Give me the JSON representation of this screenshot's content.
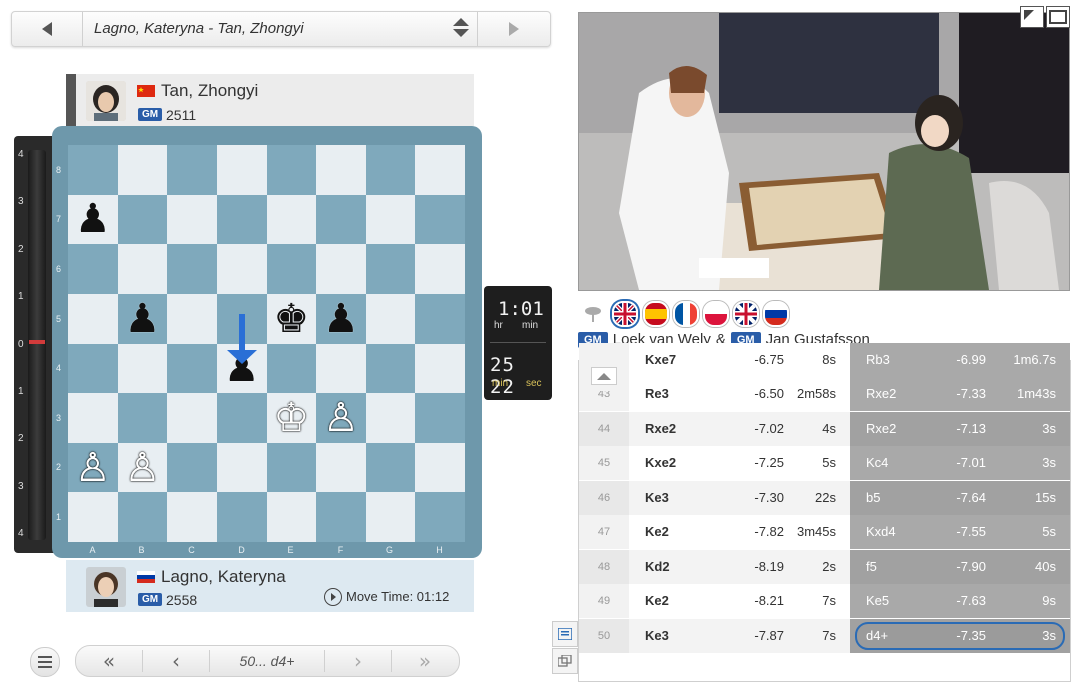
{
  "game_selector": {
    "title": "Lagno, Kateryna - Tan, Zhongyi"
  },
  "top_player": {
    "name": "Tan, Zhongyi",
    "title": "GM",
    "rating": "2511",
    "flag": "china"
  },
  "bottom_player": {
    "name": "Lagno, Kateryna",
    "title": "GM",
    "rating": "2558",
    "flag": "russia",
    "move_time": "Move Time: 01:12"
  },
  "eval_bar": {
    "labels": [
      "4",
      "3",
      "2",
      "1",
      "0",
      "1",
      "2",
      "3",
      "4"
    ],
    "current": "0"
  },
  "board": {
    "ranks": [
      "8",
      "7",
      "6",
      "5",
      "4",
      "3",
      "2",
      "1"
    ],
    "files": [
      "A",
      "B",
      "C",
      "D",
      "E",
      "F",
      "G",
      "H"
    ],
    "last_move_arrow": "d5-d4"
  },
  "clock": {
    "h_m": "1:01",
    "hr": "hr",
    "min": "min",
    "m_s": "25 22",
    "min2": "min",
    "sec": "sec"
  },
  "nav": {
    "current_move": "50... d4+"
  },
  "commentators": {
    "title1": "GM",
    "name1": "Loek van Wely",
    "amp": "&",
    "title2": "GM",
    "name2": "Jan Gustafsson"
  },
  "moves": {
    "partial": {
      "white": "Kxe7",
      "white_eval": "-6.75",
      "white_time": "8s",
      "black": "Rb3",
      "black_eval": "-6.99",
      "black_time": "1m6.7s"
    },
    "rows": [
      {
        "num": "43",
        "white": "Re3",
        "white_eval": "-6.50",
        "white_time": "2m58s",
        "black": "Rxe2",
        "black_eval": "-7.33",
        "black_time": "1m43s"
      },
      {
        "num": "44",
        "white": "Rxe2",
        "white_eval": "-7.02",
        "white_time": "4s",
        "black": "Rxe2",
        "black_eval": "-7.13",
        "black_time": "3s"
      },
      {
        "num": "45",
        "white": "Kxe2",
        "white_eval": "-7.25",
        "white_time": "5s",
        "black": "Kc4",
        "black_eval": "-7.01",
        "black_time": "3s"
      },
      {
        "num": "46",
        "white": "Ke3",
        "white_eval": "-7.30",
        "white_time": "22s",
        "black": "b5",
        "black_eval": "-7.64",
        "black_time": "15s"
      },
      {
        "num": "47",
        "white": "Ke2",
        "white_eval": "-7.82",
        "white_time": "3m45s",
        "black": "Kxd4",
        "black_eval": "-7.55",
        "black_time": "5s"
      },
      {
        "num": "48",
        "white": "Kd2",
        "white_eval": "-8.19",
        "white_time": "2s",
        "black": "f5",
        "black_eval": "-7.90",
        "black_time": "40s"
      },
      {
        "num": "49",
        "white": "Ke2",
        "white_eval": "-8.21",
        "white_time": "7s",
        "black": "Ke5",
        "black_eval": "-7.63",
        "black_time": "9s"
      },
      {
        "num": "50",
        "white": "Ke3",
        "white_eval": "-7.87",
        "white_time": "7s",
        "black": "d4+",
        "black_eval": "-7.35",
        "black_time": "3s"
      }
    ]
  },
  "colors": {
    "accent": "#2a6bb5",
    "board_dark": "#7fa9bc",
    "board_light": "#e8eef2",
    "frame": "#6e98ab",
    "gm_badge": "#2a5da8"
  }
}
